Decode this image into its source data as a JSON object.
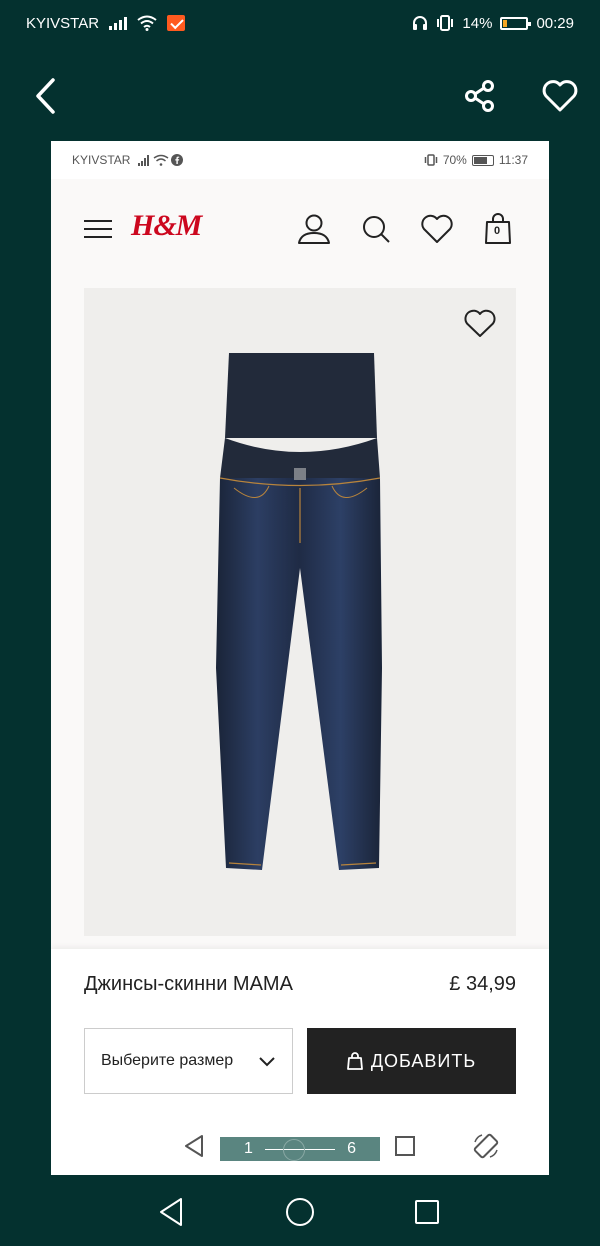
{
  "outer_status": {
    "carrier": "KYIVSTAR",
    "battery": "14%",
    "time": "00:29"
  },
  "inner_status": {
    "carrier": "KYIVSTAR",
    "battery": "70%",
    "time": "11:37"
  },
  "brand": {
    "logo": "H&M",
    "accent": "#cc071e"
  },
  "header": {
    "cart_count": "0"
  },
  "product": {
    "name": "Джинсы-скинни MAMA",
    "price": "£ 34,99"
  },
  "size_select": {
    "label": "Выберите размер"
  },
  "add_button": {
    "label": "ДОБАВИТЬ"
  },
  "pager": {
    "current": "1",
    "total": "6"
  },
  "icons": [
    "back-arrow-icon",
    "share-icon",
    "heart-icon",
    "menu-icon",
    "account-icon",
    "search-icon",
    "wishlist-icon",
    "bag-icon",
    "favorite-icon",
    "chevron-down-icon",
    "shopping-bag-icon",
    "back-triangle-icon",
    "square-icon",
    "rotate-icon",
    "home-circle-icon"
  ]
}
